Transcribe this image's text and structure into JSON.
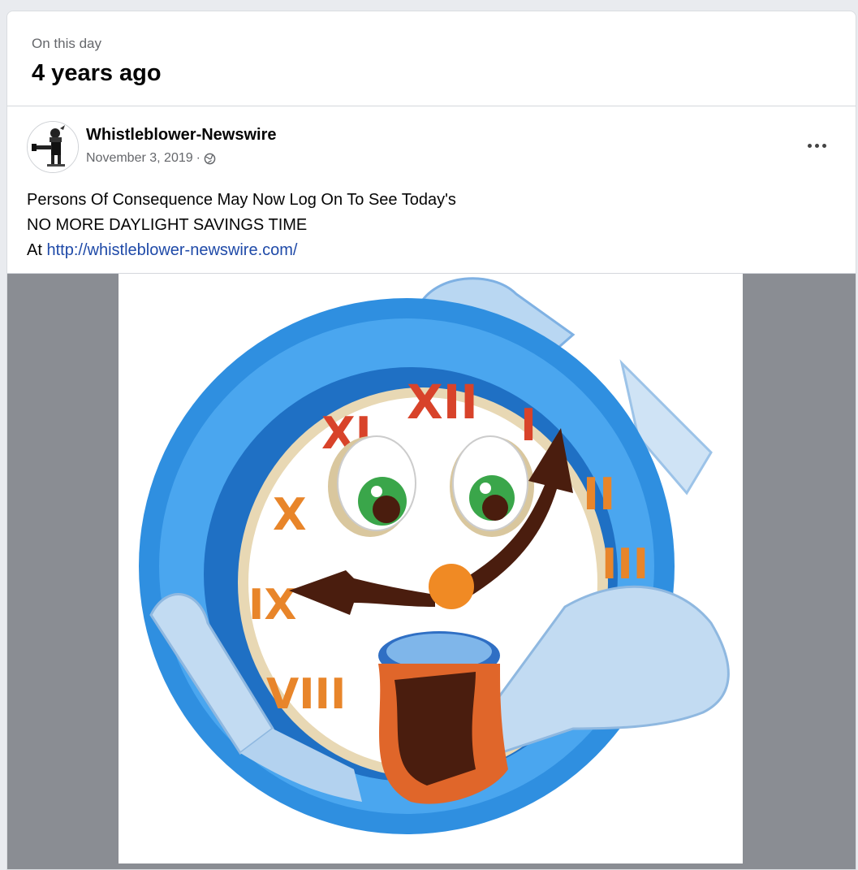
{
  "memory": {
    "label": "On this day",
    "title": "4 years ago"
  },
  "post": {
    "author": "Whistleblower-Newswire",
    "date": "November 3, 2019",
    "separator": "·",
    "audience_icon": "globe-icon",
    "more_icon": "more-options-icon",
    "text_line_1": "Persons Of Consequence May Now Log On To See Today's",
    "text_line_2": "NO MORE DAYLIGHT SAVINGS TIME",
    "text_line_3_prefix": "At",
    "link": "http://whistleblower-newswire.com/",
    "clock_numerals": [
      "XII",
      "I",
      "II",
      "III",
      "VIII",
      "IX",
      "X",
      "XI"
    ]
  },
  "colors": {
    "link": "#1f4aa8",
    "clock_blue": "#2f8fe0",
    "numeral_red": "#d8432a",
    "numeral_orange": "#e8852a",
    "media_gray": "#8a8d93"
  }
}
